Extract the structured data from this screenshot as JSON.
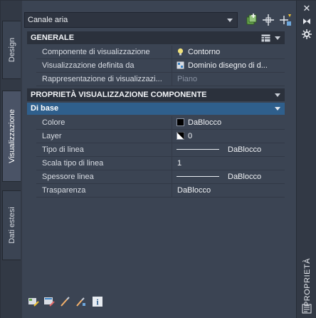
{
  "left_tabs": [
    {
      "label": "Design",
      "active": false
    },
    {
      "label": "Visualizzazione",
      "active": true
    },
    {
      "label": "Dati estesi",
      "active": false
    }
  ],
  "combo": {
    "value": "Canale aria"
  },
  "toolbar": {
    "icons": [
      "add-object-icon",
      "select-objects-icon",
      "quick-select-icon"
    ]
  },
  "general": {
    "title": "GENERALE",
    "rows": [
      {
        "key": "Componente di visualizzazione",
        "value": "Contorno",
        "icon": "lightbulb-icon"
      },
      {
        "key": "Visualizzazione definita da",
        "value": "Dominio disegno di d...",
        "icon": "drawing-domain-icon"
      },
      {
        "key": "Rappresentazione di visualizzazi...",
        "value": "Piano",
        "icon": ""
      }
    ]
  },
  "component_props": {
    "title": "PROPRIETÀ VISUALIZZAZIONE COMPONENTE",
    "subgroup": "Di base",
    "rows": [
      {
        "key": "Colore",
        "value": "DaBlocco",
        "kind": "color"
      },
      {
        "key": "Layer",
        "value": "0",
        "kind": "layer"
      },
      {
        "key": "Tipo di linea",
        "value": "DaBlocco",
        "kind": "line"
      },
      {
        "key": "Scala tipo di linea",
        "value": "1",
        "kind": "plain"
      },
      {
        "key": "Spessore linea",
        "value": "DaBlocco",
        "kind": "line"
      },
      {
        "key": "Trasparenza",
        "value": "DaBlocco",
        "kind": "plain"
      }
    ]
  },
  "bottom_icons": [
    "edit-style-icon",
    "display-properties-icon",
    "brush-icon",
    "match-properties-icon",
    "info-icon"
  ],
  "right_panel": {
    "label": "PROPRIETÀ",
    "buttons": [
      "close-icon",
      "auto-hide-icon",
      "settings-icon"
    ]
  },
  "colors": {
    "background": "#3b4453",
    "section_header": "#2b313c",
    "subgroup_header": "#2f5f8c",
    "color_swatch": "#000000"
  }
}
